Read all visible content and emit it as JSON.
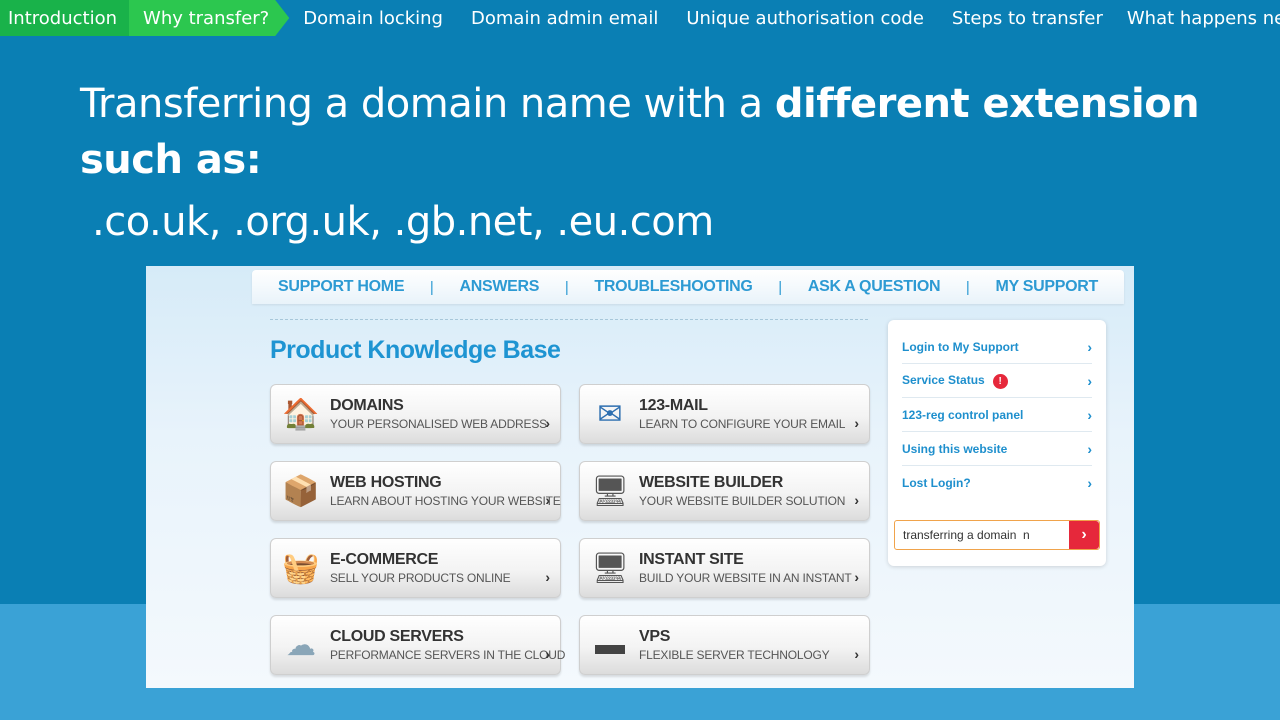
{
  "chapters": [
    {
      "label": "Introduction",
      "state": "done"
    },
    {
      "label": "Why transfer?",
      "state": "current"
    },
    {
      "label": "Domain locking",
      "state": "plain"
    },
    {
      "label": "Domain admin email",
      "state": "plain"
    },
    {
      "label": "Unique authorisation code",
      "state": "plain"
    },
    {
      "label": "Steps to transfer",
      "state": "plain"
    },
    {
      "label": "What happens next?",
      "state": "plain"
    }
  ],
  "headline": {
    "part1": "Transferring a domain name with a ",
    "bold1": "different extension",
    "line2": "such as:",
    "extensions": ".co.uk, .org.uk, .gb.net, .eu.com"
  },
  "support_nav": {
    "items": [
      "SUPPORT HOME",
      "ANSWERS",
      "TROUBLESHOOTING",
      "ASK A QUESTION",
      "MY SUPPORT"
    ],
    "separator": "|"
  },
  "kb": {
    "title": "Product Knowledge Base",
    "cards": [
      {
        "title": "DOMAINS",
        "subtitle": "YOUR PERSONALISED WEB ADDRESS",
        "icon": "house-icon",
        "glyph": "🏠"
      },
      {
        "title": "123-MAIL",
        "subtitle": "LEARN TO CONFIGURE YOUR EMAIL",
        "icon": "mail-icon",
        "glyph": "✉"
      },
      {
        "title": "WEB HOSTING",
        "subtitle": "LEARN ABOUT HOSTING YOUR WEBSITE",
        "icon": "box-icon",
        "glyph": "📦"
      },
      {
        "title": "WEBSITE BUILDER",
        "subtitle": "YOUR WEBSITE BUILDER SOLUTION",
        "icon": "monitor-icon",
        "glyph": "🖥"
      },
      {
        "title": "E-COMMERCE",
        "subtitle": "SELL YOUR PRODUCTS ONLINE",
        "icon": "basket-icon",
        "glyph": "🧺"
      },
      {
        "title": "INSTANT SITE",
        "subtitle": "BUILD YOUR WEBSITE IN AN INSTANT",
        "icon": "monitor-pen-icon",
        "glyph": "🖥"
      },
      {
        "title": "CLOUD SERVERS",
        "subtitle": "PERFORMANCE SERVERS IN THE CLOUD",
        "icon": "cloud-server-icon",
        "glyph": "☁"
      },
      {
        "title": "VPS",
        "subtitle": "FLEXIBLE SERVER TECHNOLOGY",
        "icon": "server-icon",
        "glyph": "▬"
      }
    ],
    "chevron": "›"
  },
  "side": {
    "links": [
      {
        "label": "Login to My Support"
      },
      {
        "label": "Service Status",
        "badge": "!"
      },
      {
        "label": "123-reg control panel"
      },
      {
        "label": "Using this website"
      },
      {
        "label": "Lost Login?"
      }
    ],
    "chevron": "›",
    "search_value": "transferring a domain  n",
    "search_button": "›"
  },
  "colors": {
    "background": "#0a7fb4",
    "chapter_done": "#19b24a",
    "chapter_current": "#2cc74f",
    "kb_blue": "#1e94d2",
    "alert_red": "#e6283b"
  }
}
